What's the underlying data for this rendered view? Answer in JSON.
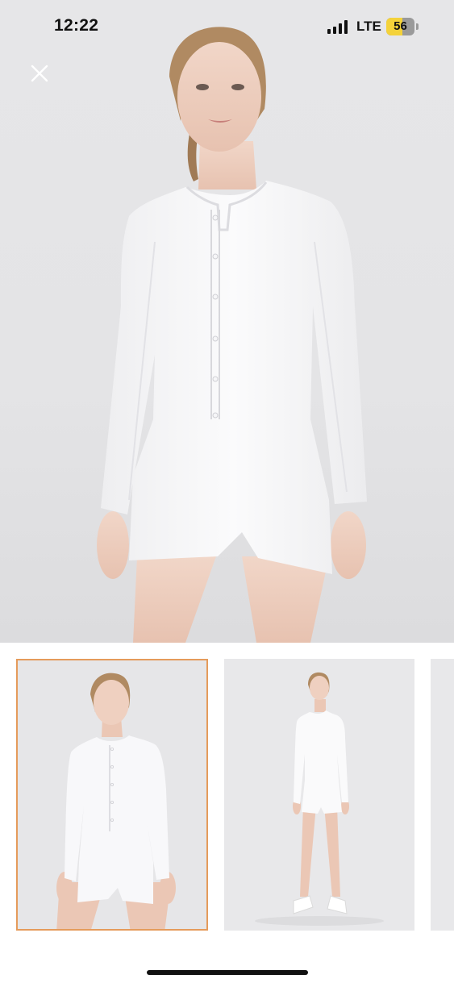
{
  "status_bar": {
    "time": "12:22",
    "network": "LTE",
    "battery_level": "56",
    "battery_fraction": 0.56,
    "signal_bars": 4
  },
  "viewer": {
    "close_icon": "close-icon",
    "selected_thumbnail_index": 0,
    "thumbnail_count_visible": 3
  },
  "colors": {
    "selected_border": "#e59b5b",
    "battery_fill": "#f4d23a",
    "background": "#ffffff"
  }
}
